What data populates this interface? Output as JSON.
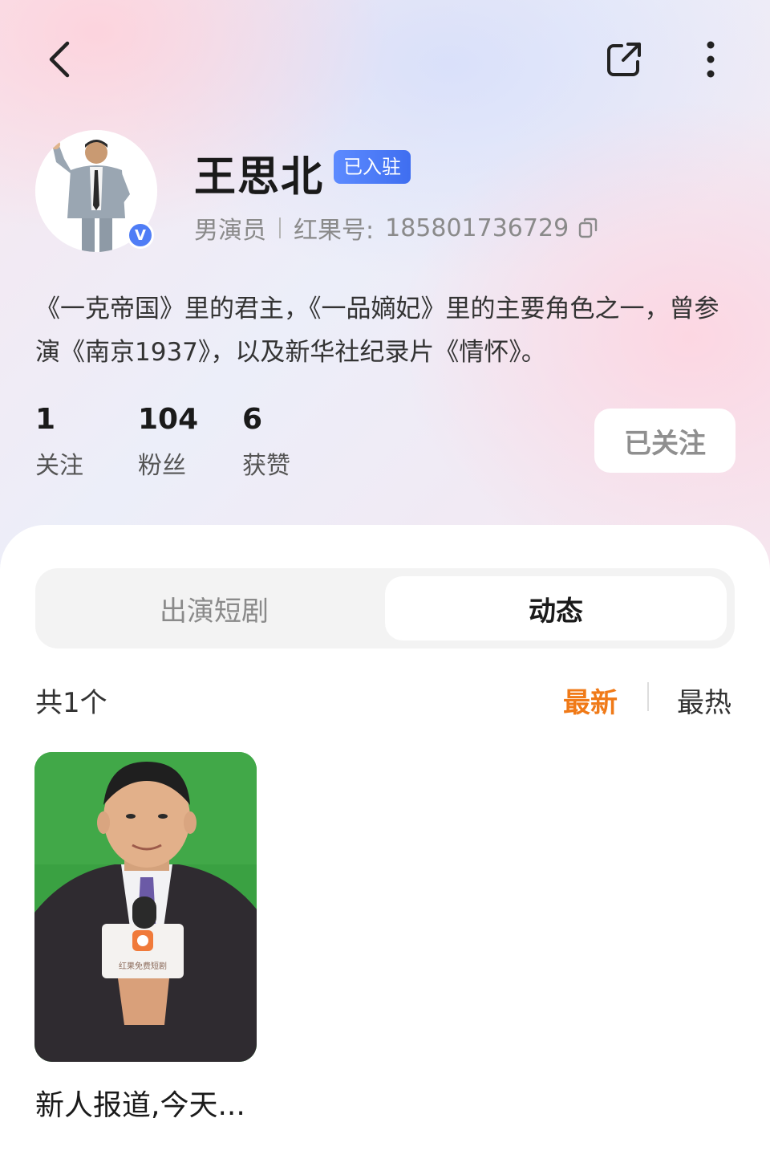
{
  "header": {
    "back_icon": "chevron-left-icon",
    "share_icon": "share-external-icon",
    "more_icon": "more-vertical-icon"
  },
  "profile": {
    "name": "王思北",
    "badge": "已入驻",
    "verified_mark": "V",
    "role": "男演员",
    "id_label": "红果号:",
    "id_value": "185801736729",
    "copy_icon": "copy-icon",
    "bio": "《一克帝国》里的君主，《一品嫡妃》里的主要角色之一，曾参演《南京1937》，以及新华社纪录片《情怀》。"
  },
  "stats": [
    {
      "value": "1",
      "label": "关注"
    },
    {
      "value": "104",
      "label": "粉丝"
    },
    {
      "value": "6",
      "label": "获赞"
    }
  ],
  "follow_button": "已关注",
  "tabs": [
    {
      "label": "出演短剧",
      "active": false
    },
    {
      "label": "动态",
      "active": true
    }
  ],
  "feed": {
    "count_label": "共1个",
    "sort_latest": "最新",
    "sort_hot": "最热",
    "sort_active_color": "#f07a18",
    "items": [
      {
        "caption": "新人报道,今天...",
        "mic_logo_text": "红果免费短剧"
      }
    ]
  },
  "colors": {
    "accent_blue": "#4f7df6",
    "accent_orange": "#f07a18"
  }
}
